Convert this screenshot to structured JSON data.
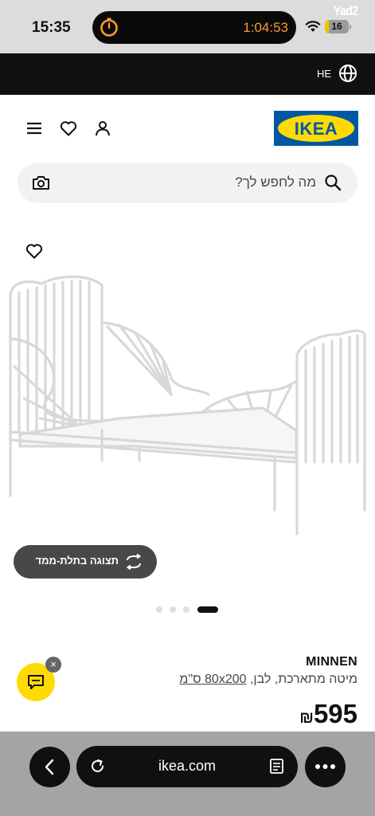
{
  "status_bar": {
    "time": "15:35",
    "timer": "1:04:53",
    "battery": "16",
    "battery_level": 0.16,
    "watermark": "Yad2",
    "timer_color": "#f59b2a"
  },
  "language_bar": {
    "language": "HE"
  },
  "header": {
    "logo_text": "IKEA",
    "logo_colors": {
      "blue": "#0058a3",
      "yellow": "#ffdb00"
    }
  },
  "search": {
    "placeholder": "מה לחפש לך?"
  },
  "gallery": {
    "view_3d_label": "תצוגה בתלת-ממד",
    "total_images": 4,
    "active_index": 4
  },
  "product": {
    "name": "MINNEN",
    "description": "מיטה מתארכת, לבן,",
    "size": "80x200 ס\"מ",
    "price": "595",
    "currency": "₪"
  },
  "chat": {
    "close_label": "×"
  },
  "browser": {
    "url": "ikea.com"
  }
}
